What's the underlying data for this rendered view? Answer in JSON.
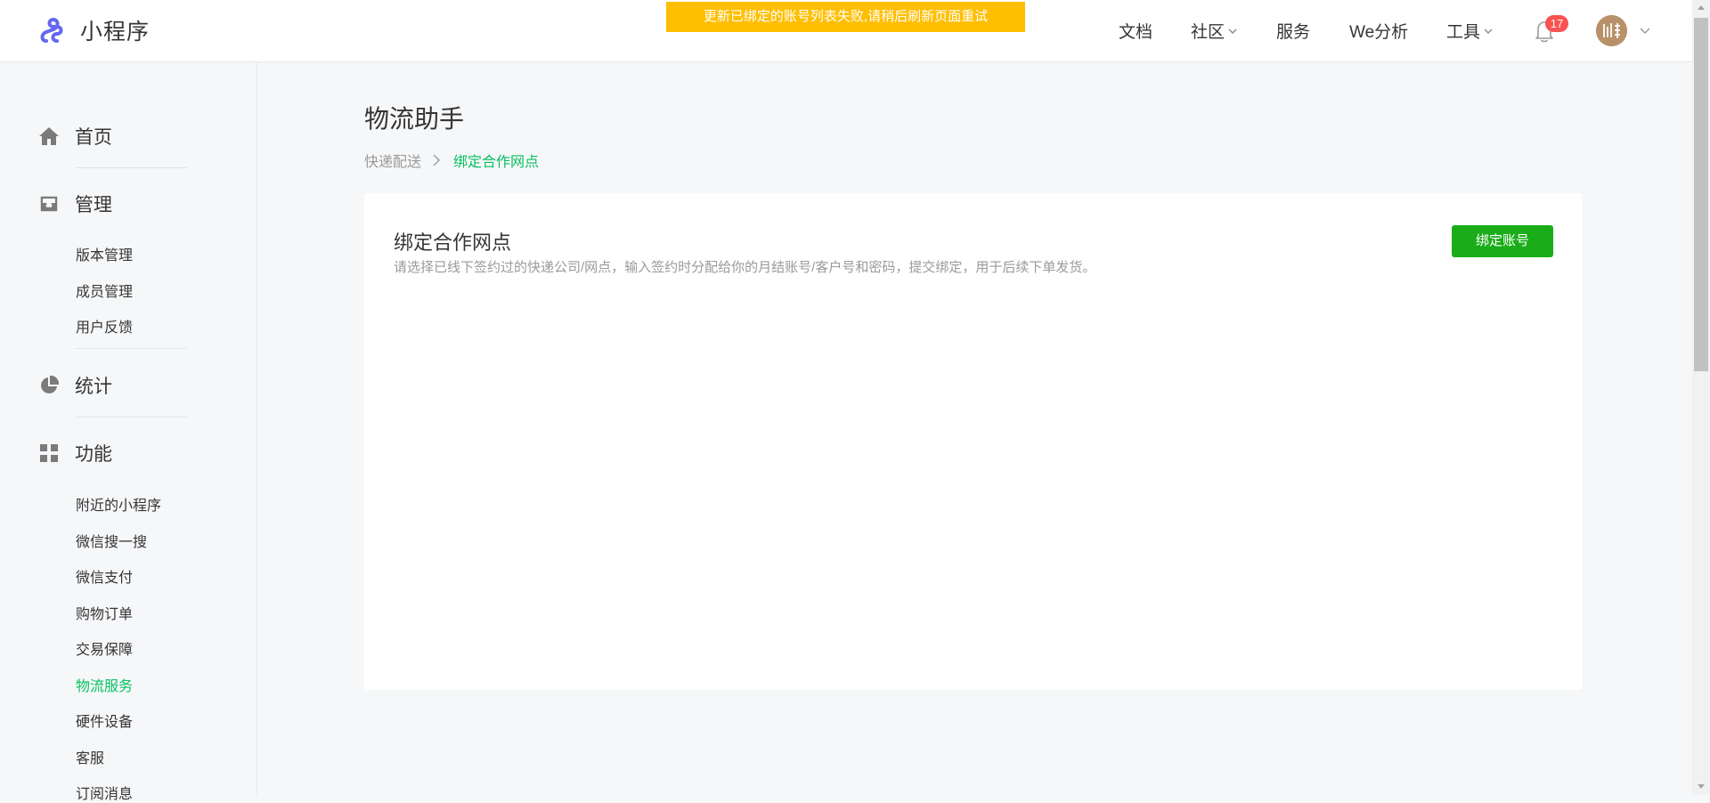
{
  "brand": {
    "name": "小程序"
  },
  "alert": {
    "text": "更新已绑定的账号列表失败,请稍后刷新页面重试"
  },
  "nav": {
    "docs": "文档",
    "community": "社区",
    "services": "服务",
    "analytics": "We分析",
    "tools": "工具",
    "notification_count": "17"
  },
  "sidebar": {
    "sections": [
      {
        "label": "首页",
        "icon": "home-icon"
      },
      {
        "label": "管理",
        "icon": "inbox-icon"
      },
      {
        "label": "统计",
        "icon": "pie-chart-icon"
      },
      {
        "label": "功能",
        "icon": "grid-icon"
      }
    ],
    "manage_items": [
      "版本管理",
      "成员管理",
      "用户反馈"
    ],
    "feature_items": [
      "附近的小程序",
      "微信搜一搜",
      "微信支付",
      "购物订单",
      "交易保障",
      "物流服务",
      "硬件设备",
      "客服",
      "订阅消息"
    ],
    "active_item": "物流服务"
  },
  "page": {
    "title": "物流助手",
    "breadcrumb": [
      "快递配送",
      "绑定合作网点"
    ]
  },
  "card": {
    "title": "绑定合作网点",
    "description": "请选择已线下签约过的快递公司/网点，输入签约时分配给你的月结账号/客户号和密码，提交绑定，用于后续下单发货。",
    "button_label": "绑定账号"
  },
  "colors": {
    "accent": "#07c160",
    "button": "#1aad19",
    "alert": "#ffbe00",
    "badge": "#fa5151"
  }
}
